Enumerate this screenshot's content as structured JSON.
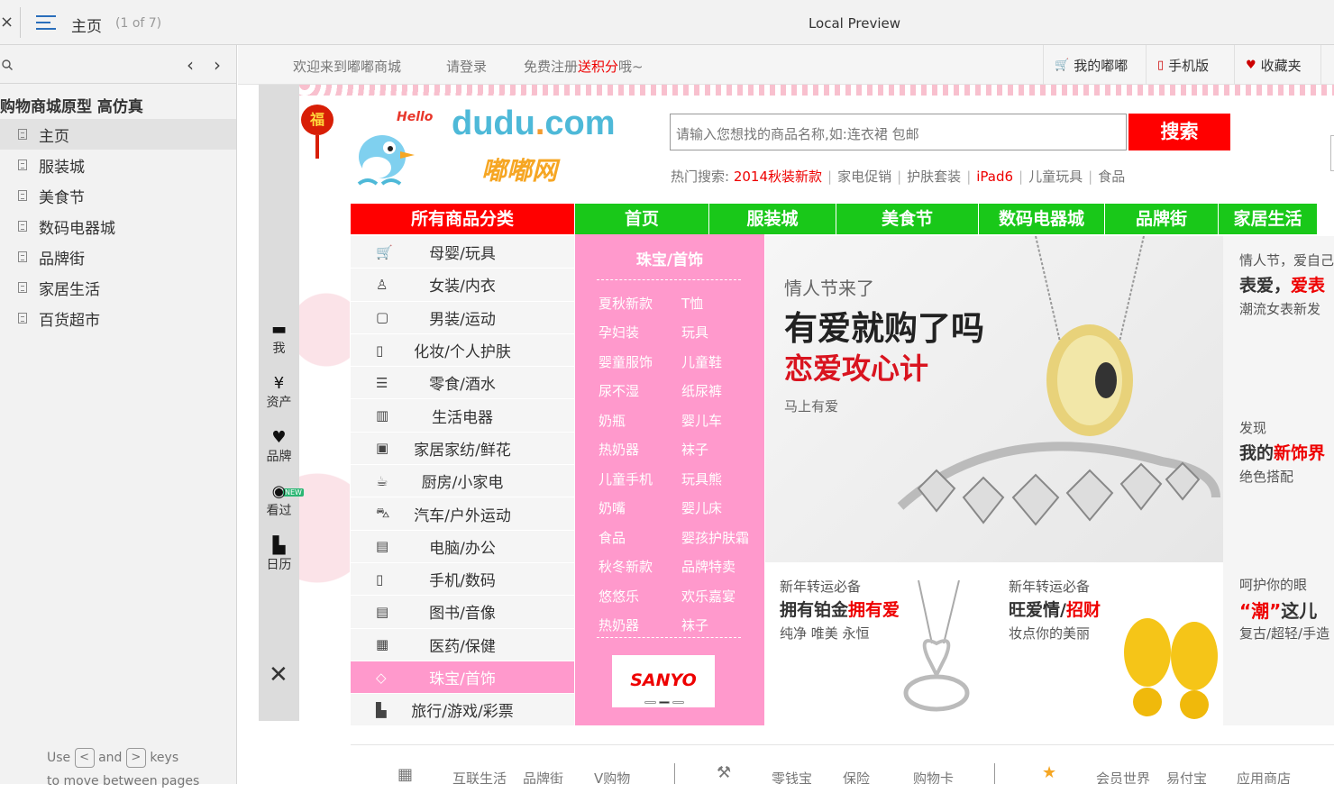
{
  "viewer": {
    "close_glyph": "×",
    "page_title": "主页",
    "page_count": "(1 of 7)",
    "center_title": "Local Preview"
  },
  "sidebar": {
    "project_title": "购物商城原型 高仿真",
    "pages": [
      {
        "label": "主页",
        "active": true
      },
      {
        "label": "服装城"
      },
      {
        "label": "美食节"
      },
      {
        "label": "数码电器城"
      },
      {
        "label": "品牌街"
      },
      {
        "label": "家居生活"
      },
      {
        "label": "百货超市"
      }
    ],
    "hint_use": "Use",
    "hint_and": "and",
    "hint_keys": "keys",
    "hint_line2": "to move between pages",
    "key_prev": "<",
    "key_next": ">"
  },
  "site": {
    "topbar": {
      "welcome": "欢迎来到嘟嘟商城",
      "login": "请登录",
      "register_pre": "免费注册",
      "register_red": "送积分",
      "register_post": "哦~",
      "my": "我的嘟嘟",
      "mobile": "手机版",
      "fav": "收藏夹"
    },
    "lantern_char": "福",
    "logo": {
      "hello": "Hello",
      "en_a": "dudu",
      "en_b": ".",
      "en_c": "com",
      "cn": "嘟嘟网"
    },
    "search": {
      "placeholder": "请输入您想找的商品名称,如:连衣裙 包邮",
      "button": "搜索"
    },
    "hot": {
      "label": "热门搜索:",
      "items": [
        {
          "t": "2014秋装新款",
          "hl": true
        },
        {
          "t": "家电促销"
        },
        {
          "t": "护肤套装"
        },
        {
          "t": "iPad6",
          "hl": true
        },
        {
          "t": "儿童玩具"
        },
        {
          "t": "食品"
        }
      ]
    },
    "nav": {
      "all": "所有商品分类",
      "items": [
        "首页",
        "服装城",
        "美食节",
        "数码电器城",
        "品牌街",
        "家居生活"
      ]
    },
    "categories": [
      {
        "icon": "🛒",
        "label": "母婴/玩具"
      },
      {
        "icon": "♙",
        "label": "女装/内衣"
      },
      {
        "icon": "▢",
        "label": "男装/运动"
      },
      {
        "icon": "▯",
        "label": "化妆/个人护肤"
      },
      {
        "icon": "☰",
        "label": "零食/酒水"
      },
      {
        "icon": "▥",
        "label": "生活电器"
      },
      {
        "icon": "▣",
        "label": "家居家纺/鲜花"
      },
      {
        "icon": "☕",
        "label": "厨房/小家电"
      },
      {
        "icon": "⛍",
        "label": "汽车/户外运动"
      },
      {
        "icon": "▤",
        "label": "电脑/办公"
      },
      {
        "icon": "▯",
        "label": "手机/数码"
      },
      {
        "icon": "▤",
        "label": "图书/音像"
      },
      {
        "icon": "▦",
        "label": "医药/保健"
      },
      {
        "icon": "◇",
        "label": "珠宝/首饰",
        "active": true
      },
      {
        "icon": "▙",
        "label": "旅行/游戏/彩票"
      }
    ],
    "subpanel": {
      "title": "珠宝/首饰",
      "rows": [
        [
          "夏秋新款",
          "T恤"
        ],
        [
          "孕妇装",
          "玩具"
        ],
        [
          "婴童服饰",
          "儿童鞋"
        ],
        [
          "尿不湿",
          "纸尿裤"
        ],
        [
          "奶瓶",
          "婴儿车"
        ],
        [
          "热奶器",
          "袜子"
        ],
        [
          "儿童手机",
          "玩具熊"
        ],
        [
          "奶嘴",
          "婴儿床"
        ],
        [
          "食品",
          "婴孩护肤霜"
        ],
        [
          "秋冬新款",
          "品牌特卖"
        ],
        [
          "悠悠乐",
          "欢乐嘉宴"
        ],
        [
          "热奶器",
          "袜子"
        ]
      ],
      "brand": "SANYO"
    },
    "banner": {
      "l1": "情人节来了",
      "l2": "有爱就购了吗",
      "l3": "恋爱攻心计",
      "l4": "马上有爱"
    },
    "promos": [
      {
        "p1": "新年转运必备",
        "p2a": "拥有铂金",
        "p2b": "拥有爱",
        "p3": "纯净 唯美 永恒"
      },
      {
        "p1": "新年转运必备",
        "p2a": "旺爱情/",
        "p2b": "招财",
        "p3": "妆点你的美丽"
      }
    ],
    "rightcol": {
      "a1": "情人节，爱自己",
      "a2a": "表爱，",
      "a2b": "爱表",
      "a3": "潮流女表新发",
      "b1": "发现",
      "b2a": "我的",
      "b2b": "新饰界",
      "b3": "绝色搭配",
      "c1": "呵护你的眼",
      "c2a": "“潮”",
      "c2b": "这儿",
      "c3": "复古/超轻/手造"
    },
    "toolbar": [
      {
        "icon": "▬",
        "label": "我"
      },
      {
        "icon": "¥",
        "label": "资产"
      },
      {
        "icon": "♥",
        "label": "品牌"
      },
      {
        "icon": "◉",
        "label": "看过"
      },
      {
        "icon": "▙",
        "label": "日历"
      }
    ],
    "toolbar_new": "NEW",
    "toolbar_close": "✕",
    "bottom": [
      "互联生活",
      "品牌街",
      "V购物",
      "零钱宝",
      "保险",
      "购物卡",
      "会员世界",
      "易付宝",
      "应用商店"
    ],
    "colors": {
      "red": "#ff0000",
      "green": "#19c819",
      "pink": "#ff99cc",
      "logo_blue": "#4eb9d8"
    }
  }
}
